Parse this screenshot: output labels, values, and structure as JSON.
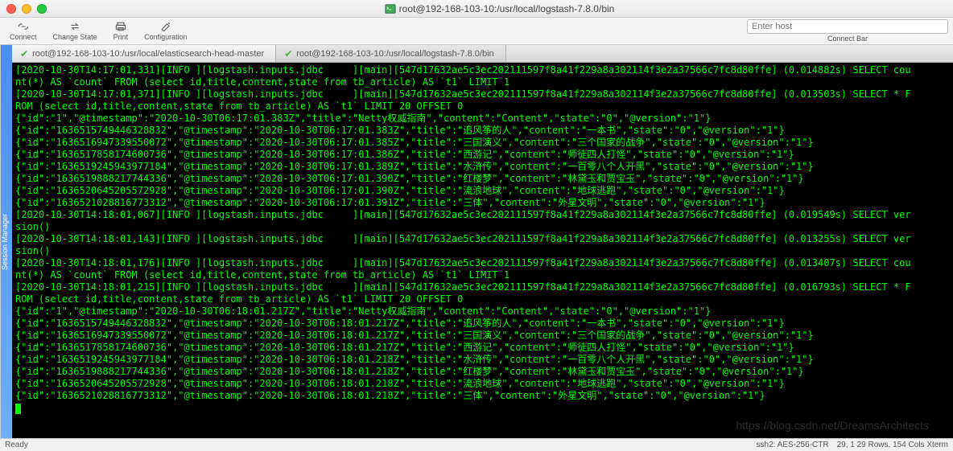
{
  "title": "root@192-168-103-10:/usr/local/logstash-7.8.0/bin",
  "toolbar": {
    "connect": "Connect",
    "change": "Change State",
    "print": "Print",
    "config": "Configuration"
  },
  "conn": {
    "placeholder": "Enter host",
    "label": "Connect Bar"
  },
  "sess": "Session Manager",
  "tabs": {
    "t1": "root@192-168-103-10:/usr/local/elasticsearch-head-master",
    "t2": "root@192-168-103-10:/usr/local/logstash-7.8.0/bin"
  },
  "l01": "[2020-10-30T14:17:01,331][INFO ][logstash.inputs.jdbc     ][main][547d17632ae5c3ec202111597f8a41f229a8a302114f3e2a37566c7fc8d80ffe] (0.014882s) SELECT cou",
  "l02": "nt(*) AS `count` FROM (select id,title,content,state from tb_article) AS `t1` LIMIT 1",
  "l03": "[2020-10-30T14:17:01,371][INFO ][logstash.inputs.jdbc     ][main][547d17632ae5c3ec202111597f8a41f229a8a302114f3e2a37566c7fc8d80ffe] (0.013503s) SELECT * F",
  "l04": "ROM (select id,title,content,state from tb_article) AS `t1` LIMIT 20 OFFSET 0",
  "l05": "{\"id\":\"1\",\"@timestamp\":\"2020-10-30T06:17:01.383Z\",\"title\":\"Netty权威指南\",\"content\":\"Content\",\"state\":\"0\",\"@version\":\"1\"}",
  "l06": "{\"id\":\"1636515749446328832\",\"@timestamp\":\"2020-10-30T06:17:01.383Z\",\"title\":\"追风筝的人\",\"content\":\"一本书\",\"state\":\"0\",\"@version\":\"1\"}",
  "l07": "{\"id\":\"1636516947339550072\",\"@timestamp\":\"2020-10-30T06:17:01.385Z\",\"title\":\"三国演义\",\"content\":\"三个国家的战争\",\"state\":\"0\",\"@version\":\"1\"}",
  "l08": "{\"id\":\"1636517858174600736\",\"@timestamp\":\"2020-10-30T06:17:01.386Z\",\"title\":\"西游记\",\"content\":\"师徒四人打怪\",\"state\":\"0\",\"@version\":\"1\"}",
  "l09": "{\"id\":\"1636519245943977184\",\"@timestamp\":\"2020-10-30T06:17:01.389Z\",\"title\":\"水浒传\",\"content\":\"一百零八个人开黑\",\"state\":\"0\",\"@version\":\"1\"}",
  "l10": "{\"id\":\"1636519888217744336\",\"@timestamp\":\"2020-10-30T06:17:01.390Z\",\"title\":\"红楼梦\",\"content\":\"林黛玉和贾宝玉\",\"state\":\"0\",\"@version\":\"1\"}",
  "l11": "{\"id\":\"1636520645205572928\",\"@timestamp\":\"2020-10-30T06:17:01.390Z\",\"title\":\"流浪地球\",\"content\":\"地球逃跑\",\"state\":\"0\",\"@version\":\"1\"}",
  "l12": "{\"id\":\"1636521028816773312\",\"@timestamp\":\"2020-10-30T06:17:01.391Z\",\"title\":\"三体\",\"content\":\"外星文明\",\"state\":\"0\",\"@version\":\"1\"}",
  "l13": "[2020-10-30T14:18:01,067][INFO ][logstash.inputs.jdbc     ][main][547d17632ae5c3ec202111597f8a41f229a8a302114f3e2a37566c7fc8d80ffe] (0.019549s) SELECT ver",
  "l14": "sion()",
  "l15": "[2020-10-30T14:18:01,143][INFO ][logstash.inputs.jdbc     ][main][547d17632ae5c3ec202111597f8a41f229a8a302114f3e2a37566c7fc8d80ffe] (0.013255s) SELECT ver",
  "l16": "sion()",
  "l17": "[2020-10-30T14:18:01,176][INFO ][logstash.inputs.jdbc     ][main][547d17632ae5c3ec202111597f8a41f229a8a302114f3e2a37566c7fc8d80ffe] (0.013407s) SELECT cou",
  "l18": "nt(*) AS `count` FROM (select id,title,content,state from tb_article) AS `t1` LIMIT 1",
  "l19": "[2020-10-30T14:18:01,215][INFO ][logstash.inputs.jdbc     ][main][547d17632ae5c3ec202111597f8a41f229a8a302114f3e2a37566c7fc8d80ffe] (0.016793s) SELECT * F",
  "l20": "ROM (select id,title,content,state from tb_article) AS `t1` LIMIT 20 OFFSET 0",
  "l21": "{\"id\":\"1\",\"@timestamp\":\"2020-10-30T06:18:01.217Z\",\"title\":\"Netty权威指南\",\"content\":\"Content\",\"state\":\"0\",\"@version\":\"1\"}",
  "l22": "{\"id\":\"1636515749446328832\",\"@timestamp\":\"2020-10-30T06:18:01.217Z\",\"title\":\"追风筝的人\",\"content\":\"一本书\",\"state\":\"0\",\"@version\":\"1\"}",
  "l23": "{\"id\":\"1636516947339550072\",\"@timestamp\":\"2020-10-30T06:18:01.217Z\",\"title\":\"三国演义\",\"content\":\"三个国家的战争\",\"state\":\"0\",\"@version\":\"1\"}",
  "l24": "{\"id\":\"1636517858174600736\",\"@timestamp\":\"2020-10-30T06:18:01.217Z\",\"title\":\"西游记\",\"content\":\"师徒四人打怪\",\"state\":\"0\",\"@version\":\"1\"}",
  "l25": "{\"id\":\"1636519245943977184\",\"@timestamp\":\"2020-10-30T06:18:01.218Z\",\"title\":\"水浒传\",\"content\":\"一百零八个人开黑\",\"state\":\"0\",\"@version\":\"1\"}",
  "l26": "{\"id\":\"1636519888217744336\",\"@timestamp\":\"2020-10-30T06:18:01.218Z\",\"title\":\"红楼梦\",\"content\":\"林黛玉和贾宝玉\",\"state\":\"0\",\"@version\":\"1\"}",
  "l27": "{\"id\":\"1636520645205572928\",\"@timestamp\":\"2020-10-30T06:18:01.218Z\",\"title\":\"流浪地球\",\"content\":\"地球逃跑\",\"state\":\"0\",\"@version\":\"1\"}",
  "l28": "{\"id\":\"1636521028816773312\",\"@timestamp\":\"2020-10-30T06:18:01.218Z\",\"title\":\"三体\",\"content\":\"外星文明\",\"state\":\"0\",\"@version\":\"1\"}",
  "status": {
    "ready": "Ready",
    "ssh": "ssh2: AES-256-CTR",
    "pos": "29, 1  29 Rows, 154 Cols  Xterm"
  },
  "wm": "https://blog.csdn.net/DreamsArchitects"
}
